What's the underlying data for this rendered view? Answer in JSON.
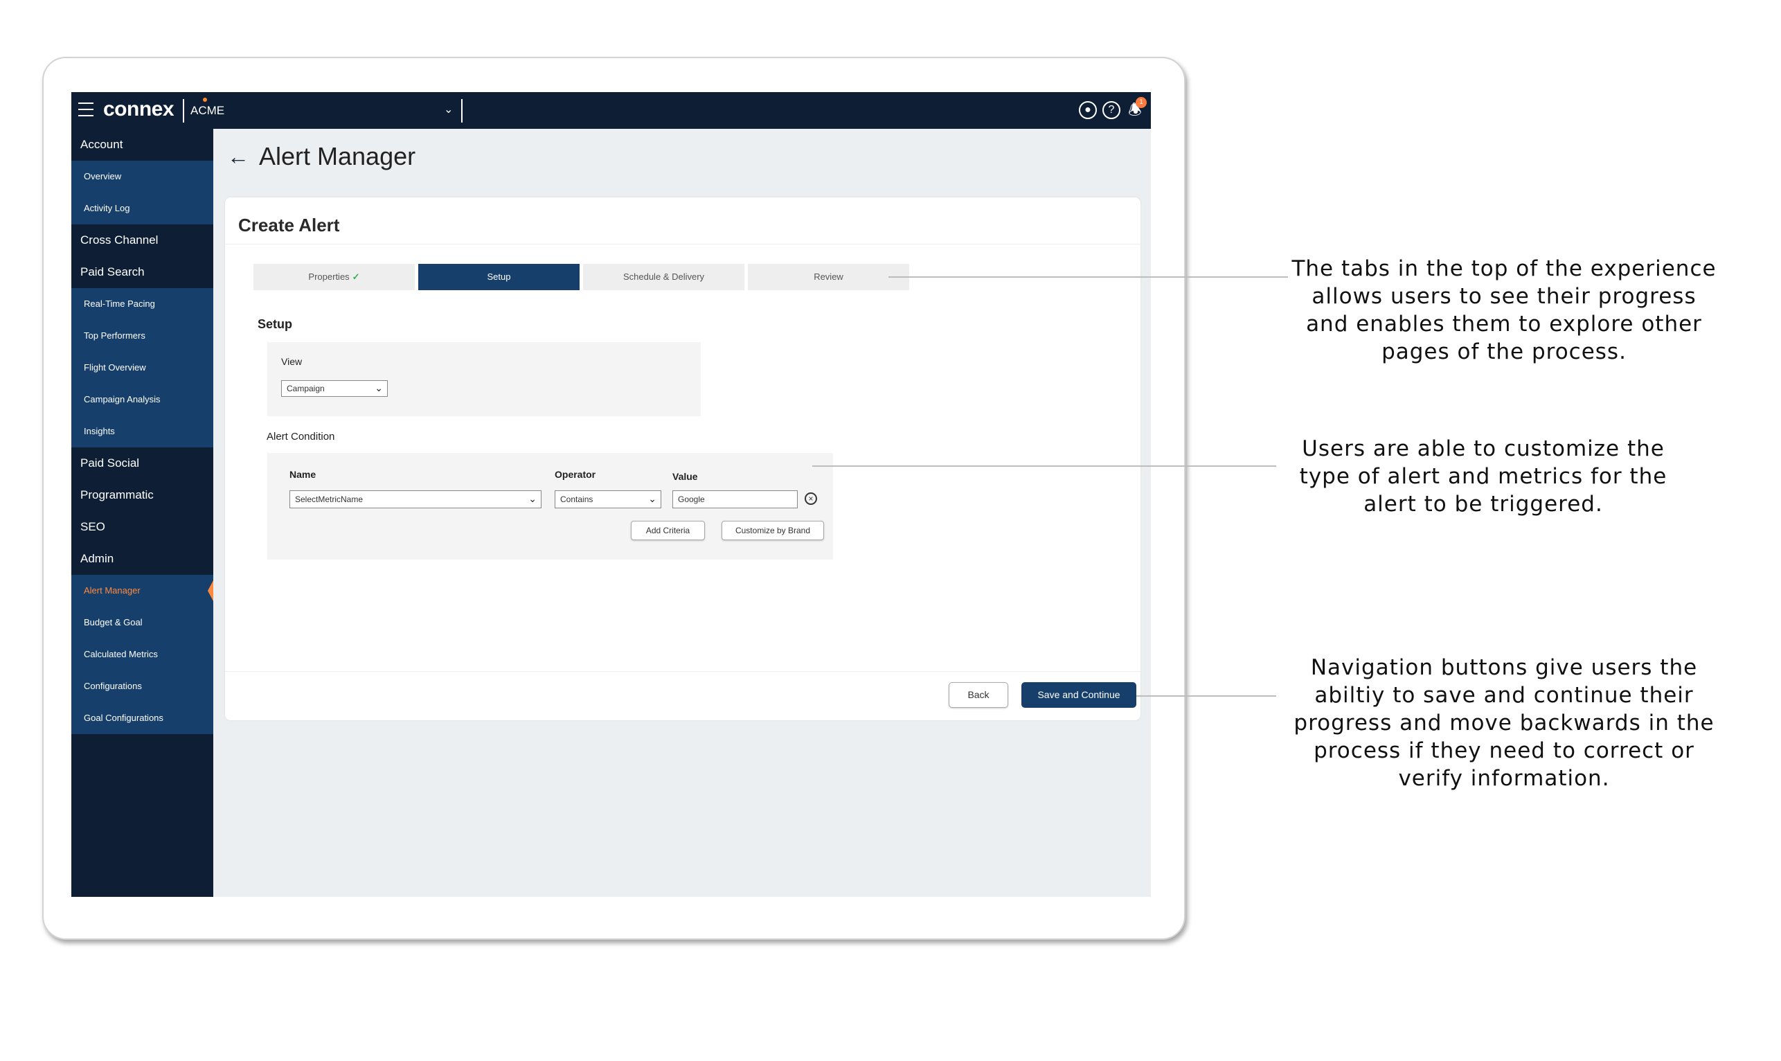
{
  "header": {
    "logo": "connex",
    "org": "ACME",
    "notification_count": "1"
  },
  "sidebar": {
    "sections": [
      {
        "label": "Account",
        "items": [
          "Overview",
          "Activity Log"
        ]
      },
      {
        "label": "Cross Channel",
        "items": []
      },
      {
        "label": "Paid Search",
        "items": [
          "Real-Time Pacing",
          "Top Performers",
          "Flight Overview",
          "Campaign Analysis",
          "Insights"
        ]
      },
      {
        "label": "Paid Social",
        "items": []
      },
      {
        "label": "Programmatic",
        "items": []
      },
      {
        "label": "SEO",
        "items": []
      },
      {
        "label": "Admin",
        "items": [
          "Alert Manager",
          "Budget & Goal",
          "Calculated Metrics",
          "Configurations",
          "Goal Configurations"
        ]
      }
    ],
    "active_item": "Alert Manager"
  },
  "page": {
    "title": "Alert Manager",
    "card_title": "Create Alert",
    "tabs": [
      {
        "label": "Properties",
        "completed": true
      },
      {
        "label": "Setup",
        "active": true
      },
      {
        "label": "Schedule & Delivery"
      },
      {
        "label": "Review"
      }
    ],
    "check_glyph": "✓",
    "section_title": "Setup",
    "view": {
      "label": "View",
      "value": "Campaign"
    },
    "alert_condition": {
      "label": "Alert Condition",
      "name_label": "Name",
      "name_value": "SelectMetricName",
      "operator_label": "Operator",
      "operator_value": "Contains",
      "value_label": "Value",
      "value_value": "Google",
      "add_criteria": "Add Criteria",
      "customize_by_brand": "Customize by Brand"
    },
    "buttons": {
      "back": "Back",
      "save": "Save and Continue"
    }
  },
  "annotations": [
    "The tabs in the top of the experience allows users to see their progress and enables them to explore other pages of the process.",
    "Users are able to customize the type of alert and metrics for the alert to be triggered.",
    "Navigation buttons give users the abiltiy to save and continue their progress and move backwards in the process if they need to correct or verify information."
  ],
  "colors": {
    "topbar": "#0e1f35",
    "sidebar_sub": "#173f6b",
    "accent": "#ff8a3d",
    "primary_button": "#173f6b",
    "check": "#2fb34a"
  }
}
